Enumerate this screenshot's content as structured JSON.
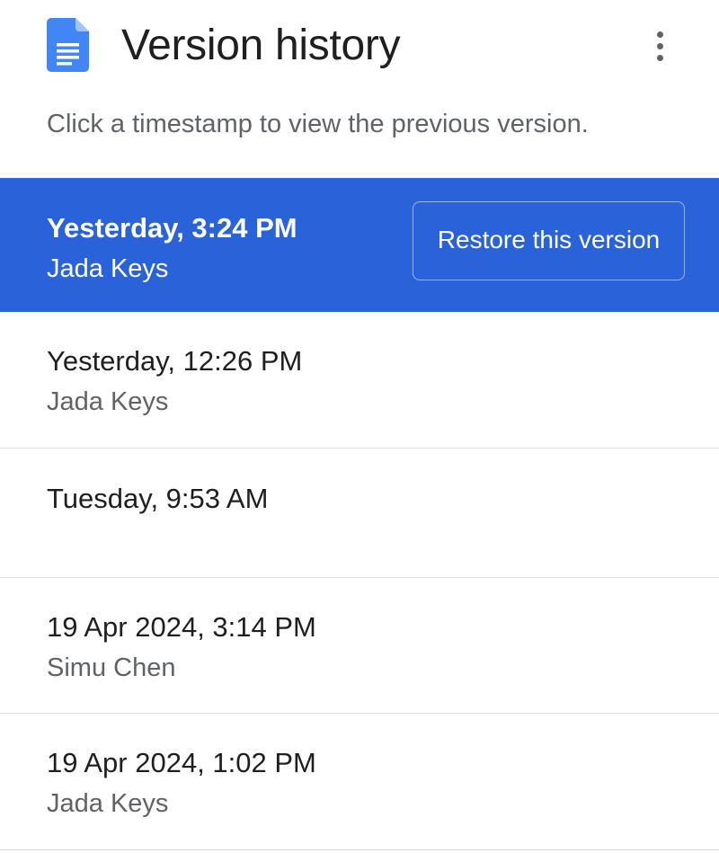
{
  "header": {
    "title": "Version history",
    "subtitle": "Click a timestamp to view the previous version.",
    "doc_icon": "google-docs-icon",
    "menu_icon": "more-vert-icon"
  },
  "colors": {
    "selected_bg": "#2962d9",
    "doc_icon_blue": "#4285f4"
  },
  "versions": [
    {
      "timestamp": "Yesterday, 3:24 PM",
      "author": "Jada Keys",
      "selected": true
    },
    {
      "timestamp": "Yesterday, 12:26 PM",
      "author": "Jada Keys",
      "selected": false
    },
    {
      "timestamp": "Tuesday, 9:53 AM",
      "author": "",
      "selected": false
    },
    {
      "timestamp": "19 Apr 2024, 3:14 PM",
      "author": "Simu Chen",
      "selected": false
    },
    {
      "timestamp": "19 Apr 2024, 1:02 PM",
      "author": "Jada Keys",
      "selected": false
    }
  ],
  "restore_label": "Restore this version"
}
